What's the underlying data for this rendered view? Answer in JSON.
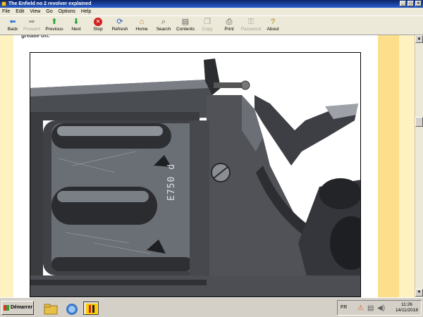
{
  "window": {
    "title": "The Enfield no 2 revolver explained"
  },
  "menu": [
    "File",
    "Edit",
    "View",
    "Go",
    "Options",
    "Help"
  ],
  "toolbar": {
    "back": "Back",
    "forward": "Forward",
    "previous": "Previous",
    "next": "Next",
    "stop": "Stop",
    "refresh": "Refresh",
    "home": "Home",
    "search": "Search",
    "contents": "Contents",
    "copy": "Copy",
    "print": "Print",
    "password": "Password",
    "about": "About"
  },
  "content": {
    "cut_text": "grease off."
  },
  "photo": {
    "marking": "E750 d"
  },
  "taskbar": {
    "start_label": "Démarrer",
    "language": "FR",
    "time": "11:26",
    "date": "14/11/2018"
  }
}
